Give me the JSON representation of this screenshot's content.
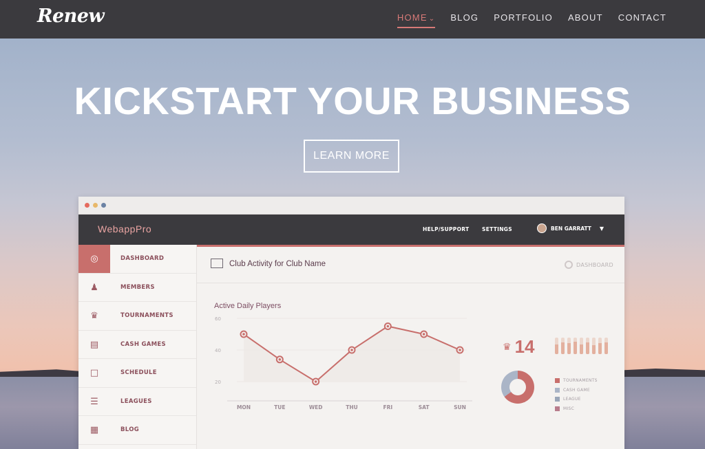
{
  "site": {
    "logo": "Renew",
    "nav": [
      {
        "label": "HOME",
        "active": true
      },
      {
        "label": "BLOG",
        "active": false
      },
      {
        "label": "PORTFOLIO",
        "active": false
      },
      {
        "label": "ABOUT",
        "active": false
      },
      {
        "label": "CONTACT",
        "active": false
      }
    ],
    "nav_active_indicator": "chevron-down-icon",
    "accent_color": "#d97a78"
  },
  "hero": {
    "headline": "KICKSTART YOUR BUSINESS",
    "cta_label": "LEARN MORE"
  },
  "app": {
    "title": "WebappPro",
    "header_links": [
      "HELP/SUPPORT",
      "SETTINGS"
    ],
    "user_name": "BEN GARRATT",
    "user_caret": "▼",
    "accent_color": "#c86f6c",
    "sidebar": [
      {
        "label": "DASHBOARD",
        "icon": "dashboard-icon",
        "active": true
      },
      {
        "label": "MEMBERS",
        "icon": "members-icon",
        "active": false
      },
      {
        "label": "TOURNAMENTS",
        "icon": "crown-icon",
        "active": false
      },
      {
        "label": "CASH GAMES",
        "icon": "cash-icon",
        "active": false
      },
      {
        "label": "SCHEDULE",
        "icon": "calendar-icon",
        "active": false
      },
      {
        "label": "LEAGUES",
        "icon": "list-icon",
        "active": false
      },
      {
        "label": "BLOG",
        "icon": "blog-icon",
        "active": false
      }
    ],
    "main": {
      "title": "Club Activity for Club Name",
      "breadcrumb": "DASHBOARD",
      "chart_title": "Active Daily Players",
      "stat_value": "14",
      "stat_icon": "crown-icon",
      "mini_bars": [
        0.6,
        0.7,
        0.65,
        0.75,
        0.6,
        0.7,
        0.55,
        0.65,
        0.7
      ],
      "legend": [
        {
          "label": "TOURNAMENTS",
          "color": "#c86f6c"
        },
        {
          "label": "CASH GAME",
          "color": "#aab5c7"
        },
        {
          "label": "LEAGUE",
          "color": "#9aa6b8"
        },
        {
          "label": "MISC",
          "color": "#b87c8c"
        }
      ]
    }
  },
  "chart_data": {
    "type": "line",
    "title": "Active Daily Players",
    "categories": [
      "MON",
      "TUE",
      "WED",
      "THU",
      "FRI",
      "SAT",
      "SUN"
    ],
    "values": [
      50,
      34,
      20,
      40,
      55,
      50,
      40
    ],
    "ylim": [
      0,
      60
    ],
    "yticks": [
      20,
      40,
      60
    ],
    "grid": true,
    "color": "#c86f6c"
  }
}
